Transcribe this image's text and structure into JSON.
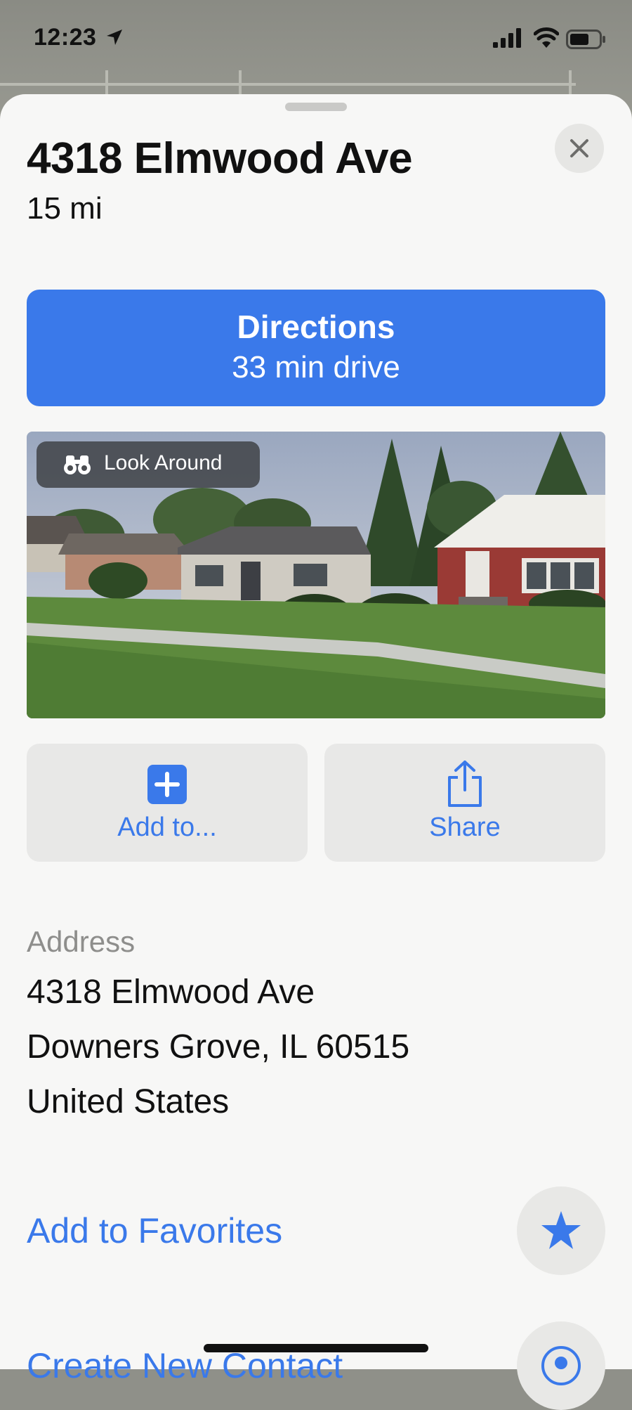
{
  "status_bar": {
    "time": "12:23",
    "location_icon": "location-arrow-icon",
    "signal_icon": "cellular-signal-icon",
    "wifi_icon": "wifi-icon",
    "battery_icon": "battery-icon"
  },
  "place": {
    "title": "4318 Elmwood Ave",
    "distance": "15 mi"
  },
  "close_icon": "close-icon",
  "directions": {
    "label": "Directions",
    "subtitle": "33 min drive"
  },
  "look_around": {
    "label": "Look Around",
    "icon": "binoculars-icon"
  },
  "actions": [
    {
      "label": "Add to...",
      "icon": "plus-square-icon"
    },
    {
      "label": "Share",
      "icon": "share-icon"
    }
  ],
  "address": {
    "heading": "Address",
    "line1": "4318 Elmwood Ave",
    "line2": "Downers Grove, IL  60515",
    "line3": "United States"
  },
  "favorites": {
    "label": "Add to Favorites",
    "icon": "star-icon"
  },
  "contact": {
    "label": "Create New Contact",
    "icon": "contact-icon"
  },
  "colors": {
    "accent": "#3a79ea",
    "sheet_bg": "#f7f7f6",
    "tile_bg": "#e8e8e7"
  }
}
